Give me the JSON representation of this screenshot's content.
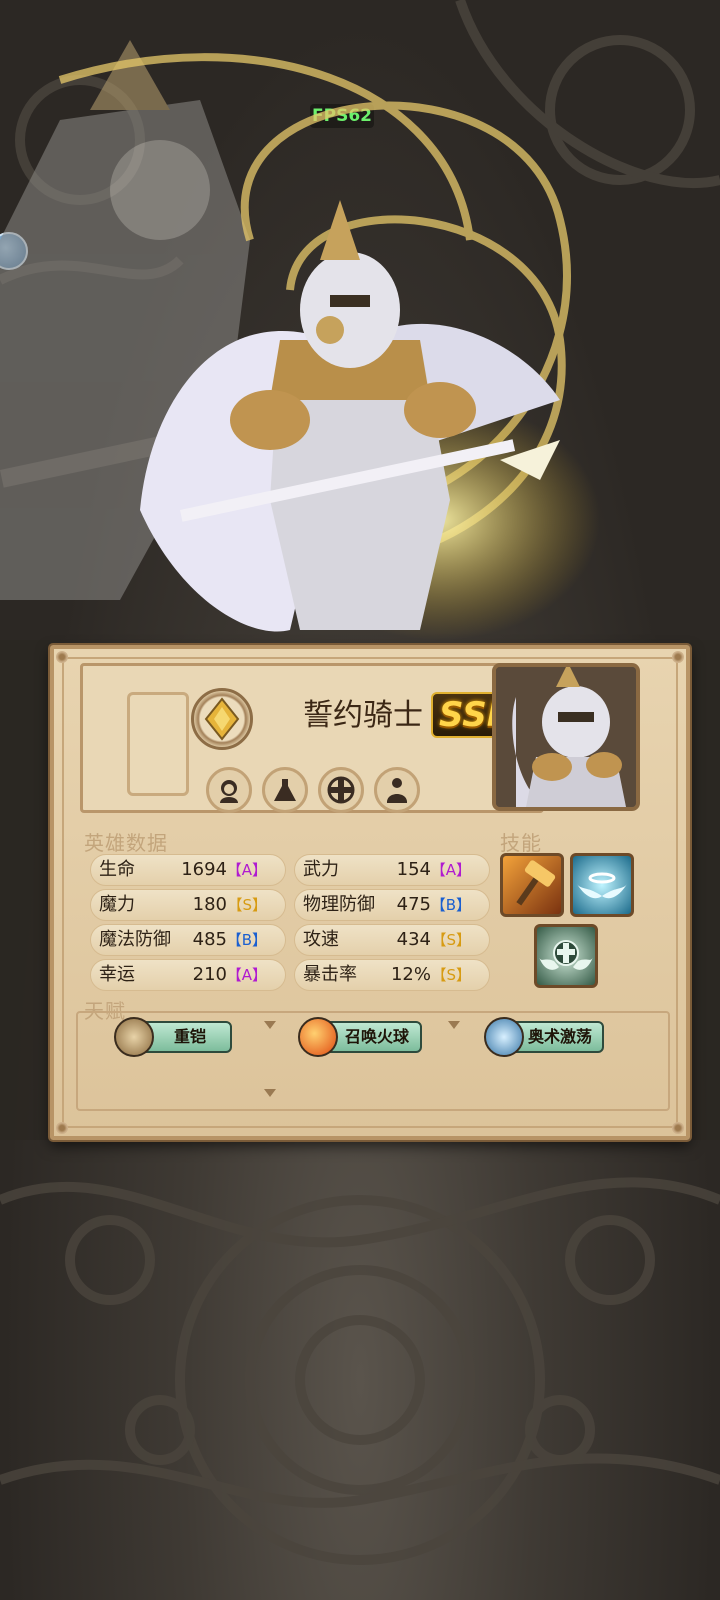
{
  "hud": {
    "fps": "FPS62"
  },
  "hero": {
    "name": "誓约骑士",
    "rarity": "SSR",
    "tags": [
      "female-face-icon",
      "flask-icon",
      "cross-icon",
      "heavy-body-icon"
    ]
  },
  "sections": {
    "stats_title": "英雄数据",
    "skills_title": "技能",
    "talents_title": "天赋"
  },
  "stats": {
    "left": [
      {
        "name": "生命",
        "value": "1694",
        "grade": "【A】",
        "grade_color": "#b01ad0"
      },
      {
        "name": "魔力",
        "value": "180",
        "grade": "【S】",
        "grade_color": "#d79b12"
      },
      {
        "name": "魔法防御",
        "value": "485",
        "grade": "【B】",
        "grade_color": "#1a5fd0"
      },
      {
        "name": "幸运",
        "value": "210",
        "grade": "【A】",
        "grade_color": "#b01ad0"
      }
    ],
    "right": [
      {
        "name": "武力",
        "value": "154",
        "grade": "【A】",
        "grade_color": "#b01ad0"
      },
      {
        "name": "物理防御",
        "value": "475",
        "grade": "【B】",
        "grade_color": "#1a5fd0"
      },
      {
        "name": "攻速",
        "value": "434",
        "grade": "【S】",
        "grade_color": "#d79b12"
      },
      {
        "name": "暴击率",
        "value": "12%",
        "grade": "【S】",
        "grade_color": "#d79b12"
      }
    ]
  },
  "skills": [
    "hammer-skill-icon",
    "winged-halo-skill-icon",
    "winged-cross-skill-icon"
  ],
  "talents": [
    {
      "label": "重铠",
      "icon": "armored-warrior-icon"
    },
    {
      "label": "召唤火球",
      "icon": "fireball-icon"
    },
    {
      "label": "奥术激荡",
      "icon": "arcane-mage-icon"
    }
  ]
}
